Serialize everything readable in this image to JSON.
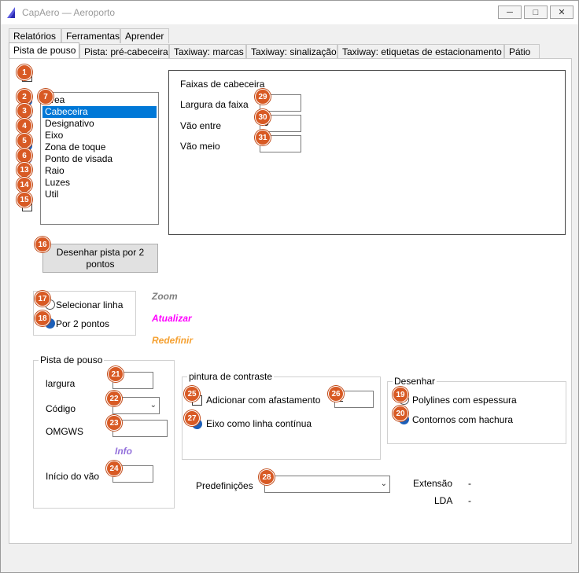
{
  "window": {
    "title": "CapAero — Aeroporto",
    "minimize_icon": "minimize-icon",
    "maximize_icon": "maximize-icon",
    "close_icon": "close-icon"
  },
  "menu_tabs": [
    "Relatórios",
    "Ferramentas",
    "Aprender"
  ],
  "tabs": [
    "Pista de pouso",
    "Pista: pré-cabeceira",
    "Taxiway: marcas",
    "Taxiway: sinalização",
    "Taxiway: etiquetas de estacionamento",
    "Pátio"
  ],
  "list": {
    "items": [
      "Área",
      "Cabeceira",
      "Designativo",
      "Eixo",
      "Zona de toque",
      "Ponto de visada",
      "Raio",
      "Luzes",
      "Util"
    ],
    "selected": "Cabeceira"
  },
  "faixas": {
    "title": "Faixas de cabeceira",
    "largura_label": "Largura da faixa",
    "largura_value": "",
    "vao_entre_label": "Vão entre",
    "vao_entre_value": "5",
    "vao_meio_label": "Vão meio",
    "vao_meio_value": ""
  },
  "draw_button": "Desenhar pista por 2 pontos",
  "selection": {
    "opt1": "Selecionar linha",
    "opt2": "Por 2 pontos"
  },
  "links": {
    "zoom": "Zoom",
    "atualizar": "Atualizar",
    "redefinir": "Redefinir",
    "info": "Info"
  },
  "link_colors": {
    "zoom": "#808080",
    "atualizar": "#ff00ff",
    "redefinir": "#f5a030",
    "info": "#9370db"
  },
  "pista": {
    "title": "Pista de pouso",
    "largura_label": "largura",
    "largura_value": "",
    "codigo_label": "Código",
    "codigo_value": "",
    "omgws_label": "OMGWS",
    "omgws_value": "",
    "inicio_label": "Início do vão",
    "inicio_value": ""
  },
  "contraste": {
    "title": "pintura de contraste",
    "opt1": "Adicionar com afastamento",
    "afast_value": "2",
    "opt2": "Eixo como linha contínua"
  },
  "desenhar": {
    "title": "Desenhar",
    "opt1": "Polylines com espessura",
    "opt2": "Contornos com hachura"
  },
  "predef": {
    "label": "Predefinições",
    "value": ""
  },
  "info": {
    "extensao_label": "Extensão",
    "extensao_value": "-",
    "lda_label": "LDA",
    "lda_value": "-"
  },
  "badges": [
    "1",
    "2",
    "3",
    "4",
    "5",
    "6",
    "7",
    "13",
    "14",
    "15",
    "16",
    "17",
    "18",
    "19",
    "20",
    "21",
    "22",
    "23",
    "24",
    "25",
    "26",
    "27",
    "28",
    "29",
    "30",
    "31"
  ]
}
